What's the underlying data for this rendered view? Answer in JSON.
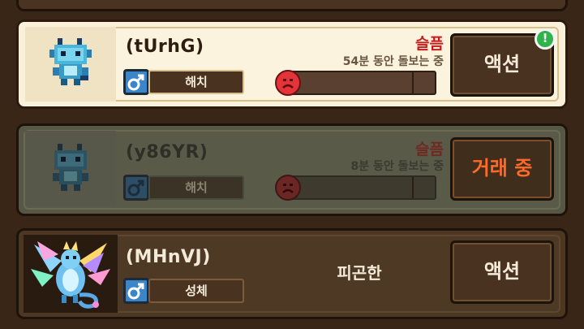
{
  "pets": [
    {
      "name": "(tUrhG)",
      "gender_icon": "male-icon",
      "stage": "해치",
      "mood": "슬픔",
      "since": "54분 동안 돌보는 중",
      "mood_level": 0.05,
      "action": "액션",
      "alert": "!",
      "sprite": "blue-dragon-hatchling"
    },
    {
      "name": "(y86YR)",
      "gender_icon": "male-icon",
      "stage": "해치",
      "mood": "슬픔",
      "since": "8분 동안 돌보는 중",
      "mood_level": 0.05,
      "action": "거래 중",
      "sprite": "blue-dragon-hatchling"
    },
    {
      "name": "(MHnVJ)",
      "gender_icon": "male-icon",
      "stage": "성체",
      "status": "피곤한",
      "action": "액션",
      "sprite": "rainbow-dragon-adult"
    }
  ],
  "colors": {
    "card_active": "#faf1db",
    "card_disabled": "#575746",
    "card_default": "#4c3722",
    "mood_sad": "#c51c1c",
    "trading_text": "#ff6a2a",
    "alert_badge": "#2fb34a"
  }
}
